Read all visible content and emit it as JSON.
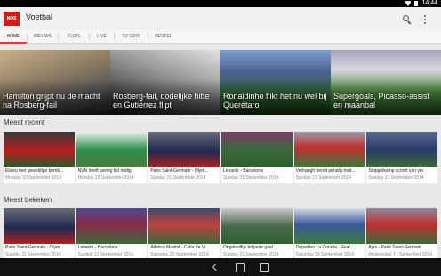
{
  "status_bar": {
    "time": "14:44"
  },
  "app_bar": {
    "logo_text": "NOS",
    "title": "Voetbal"
  },
  "tabs": [
    {
      "label": "HOME",
      "active": true
    },
    {
      "label": "NIEUWS",
      "active": false
    },
    {
      "label": "CLIPS",
      "active": false
    },
    {
      "label": "LIVE",
      "active": false
    },
    {
      "label": "TV GIDS",
      "active": false
    },
    {
      "label": "BESTEL",
      "active": false
    }
  ],
  "hero": [
    {
      "caption": "Hamilton grijpt nu de macht na Rosberg-fail"
    },
    {
      "caption": "Rosberg-fail, dodelijke hitte en Gutiérrez flipt"
    },
    {
      "caption": "Ronaldinho flikt het nu wel bij Querétaro"
    },
    {
      "caption": "Supergoals, Picasso-assist en maanbal"
    }
  ],
  "sections": {
    "recent_title": "Meest recent",
    "viewed_title": "Meest bekeken"
  },
  "recent": [
    {
      "title": "Eliseu met geweldige bomb...",
      "date": "Monday 22 September 2014"
    },
    {
      "title": "NVN heeft weinig tijd nodig",
      "date": "Monday 22 September 2014"
    },
    {
      "title": "Paris Saint-Germain - Olym...",
      "date": "Sunday 21 September 2014"
    },
    {
      "title": "Levante - Barcelona",
      "date": "Sunday 21 September 2014"
    },
    {
      "title": "Verhaegh benut penalty met...",
      "date": "Sunday 21 September 2014"
    },
    {
      "title": "Stoppelkamp scoort van ver",
      "date": "Sunday 21 September 2014"
    }
  ],
  "viewed": [
    {
      "title": "Paris Saint-Germain - Olym...",
      "date": "Sunday 21 September 2014"
    },
    {
      "title": "Levante - Barcelona",
      "date": "Sunday 21 September 2014"
    },
    {
      "title": "Atletico Madrid - Celta de Vi...",
      "date": "Saturday 20 September 2014"
    },
    {
      "title": "Ongelooflijk briljante goal ...",
      "date": "Sunday 21 September 2014"
    },
    {
      "title": "Deportivo La Coruña - Real ...",
      "date": "Saturday 20 September 2014"
    },
    {
      "title": "Ajax - Paris Saint-Germain",
      "date": "Wednesday 17 September 2014"
    }
  ],
  "icons": {
    "search": "search-icon",
    "overflow": "overflow-menu-icon"
  },
  "colors": {
    "accent": "#e33333",
    "logo_bg": "#d41a1a"
  }
}
